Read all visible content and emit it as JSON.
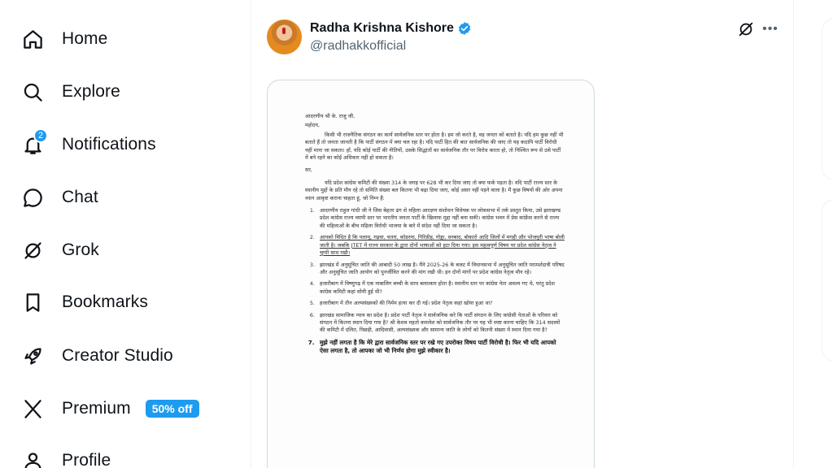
{
  "sidebar": {
    "items": [
      {
        "label": "Home",
        "icon": "home-icon"
      },
      {
        "label": "Explore",
        "icon": "search-icon"
      },
      {
        "label": "Notifications",
        "icon": "bell-icon",
        "badge": "2"
      },
      {
        "label": "Chat",
        "icon": "chat-icon"
      },
      {
        "label": "Grok",
        "icon": "grok-icon"
      },
      {
        "label": "Bookmarks",
        "icon": "bookmark-icon"
      },
      {
        "label": "Creator Studio",
        "icon": "rocket-icon"
      },
      {
        "label": "Premium",
        "icon": "x-logo-icon",
        "promo": "50% off"
      },
      {
        "label": "Profile",
        "icon": "person-icon"
      }
    ]
  },
  "tweet": {
    "author_name": "Radha Krishna Kishore",
    "author_handle": "@radhakkofficial",
    "verified": true,
    "accent_color": "#1d9bf0"
  },
  "document": {
    "salutation": "आदरणीय श्री के. राजु जी,",
    "greeting": "महोदय,",
    "para1": "किसी भी राजनैतिक संगठन का कार्य सार्वजनिक स्तर पर होता है। हम जो करते है, वह जनता को बताते है। यदि हम कुछ नहीं भी बताते हैं तो जनता जानती है कि पार्टी संगठन में क्या चल रहा है। यदि पार्टी हित की बात सार्वजनिक की जाए तो यह कदापि पार्टी विरोधी नहीं माना जा सकता। हाँ, यदि कोई पार्टी की नीतियों, उसके सिद्धांतों का सार्वजनिक तौर पर विरोध करता हो, तो निश्चित रूप से उसे पार्टी में बने रहने का कोई अधिकार नहीं हो सकता है।",
    "sir": "सर,",
    "para2": "यदि प्रदेश कांग्रेस कमिटी की संख्या 314 के जगह पर 628 भी कर दिया जाए तो क्या फर्क पड़ता है। यदि पार्टी राज्य स्तर के स्थानीय मुद्दों के प्रति मौन रहे तो समिति संख्या बल कितना भी बढ़ा दिया जाए, कोई असर नहीं पड़ने वाला है। मैं कुछ विषयों की ओर अपना ध्यान आकृष्ट कराना चाहता हूं, जो निम्न हैं:",
    "points": [
      "आदरणीय राहुल गांधी जी ने जिस बेहतर ढंग से महिला आरक्षण संशोधन विधेयक पर लोकसभा में तर्क प्रस्तुत किया, उसे झारखण्ड प्रदेश कांग्रेस राज्य व्यापी स्तर पर भारतीय जनता पार्टी के खिलाफ मुद्दा नहीं बना सकी। कांग्रेस भवन में प्रेस कांफ्रेंस करने से राज्य की महिलाओं के बीच महिला विरोधी भाजपा के बारे में संदेश नहीं दिया जा सकता है।",
      "आपको विदित है कि पलामू, गढ़वा, चतरा, कोडरमा, गिरिडीह, गोड्डा, धनबाद, बोकारो आदि जिलों में मगही और भोजपुरी भाषा बोली जाती है। जबकि JTET में राज्य सरकार के द्वारा दोनों भाषाओं को हटा दिया गया। इस महत्वपूर्ण विषय पर प्रदेश कांग्रेस नेतृत्व ने चुप्पी साध रखी।",
      "झारखंड में अनुसूचित जाति की आबादी 50 लाख है। मैंने 2025-26 के बजट में विधानसभा में अनुसूचित जाति परामर्शदात्री परिषद और अनुसूचित जाति आयोग को पुनर्जीवित करने की मांग रखी थी। इन दोनों मांगों पर प्रदेश कांग्रेस नेतृत्व मौन रहे।",
      "हजारीबाग में विष्णुगढ़ में एक नाबालिग बच्ची के साथ बलात्कार होता है। स्थानीय स्तर पर कांग्रेस नेता अवश्य गए थे, परंतु प्रदेश कांग्रेस कमिटी कहां सोयी हुई थी?",
      "हजारीबाग में तीन अल्पसंख्यकों की निर्मम हत्या कर दी गई। प्रदेश नेतृत्व कहां खोया हुआ था?",
      "झारखंड सामाजिक न्याय का प्रदेश है। प्रदेश पार्टी नेतृत्व ने सार्वजनिक करे कि पार्टी संगठन के लिए कांग्रेसी नेताओं के परिवार को संगठन में कितना स्थान दिया गया है? श्री केशव महतो कमलेश को सार्वजनिक तौर पर यह भी स्पष्ट करना चाहिए कि 314 सदस्यों की कमिटी में दलित, पिछड़ी, आदिवासी, अल्पसंख्यक और सामान्य जाति के लोगों को कितनी संख्या में स्थान दिया गया है?",
      "मुझे नहीं लगता है कि मेरे द्वारा सार्वजनिक स्तर पर रखे गए उपरोक्त विषय पार्टी विरोधी है। फिर भी यदि आपको ऐसा लगता है, तो आपका जो भी निर्णय होगा मुझे स्वीकार है।"
    ]
  }
}
